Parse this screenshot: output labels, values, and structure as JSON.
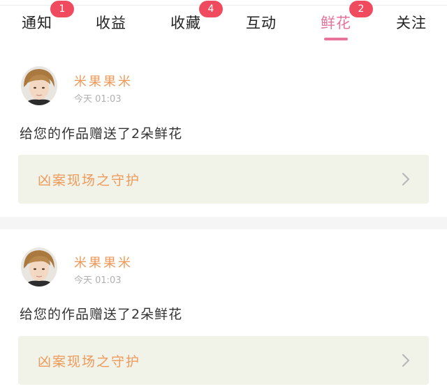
{
  "tabs": [
    {
      "label": "通知",
      "badge": "1",
      "active": false
    },
    {
      "label": "收益",
      "badge": "",
      "active": false
    },
    {
      "label": "收藏",
      "badge": "4",
      "active": false
    },
    {
      "label": "互动",
      "badge": "",
      "active": false
    },
    {
      "label": "鲜花",
      "badge": "2",
      "active": true
    },
    {
      "label": "关注",
      "badge": "",
      "active": false
    }
  ],
  "notifications": [
    {
      "username": "米果果米",
      "time": "今天 01:03",
      "message": "给您的作品赠送了2朵鲜花",
      "work_title": "凶案现场之守护"
    },
    {
      "username": "米果果米",
      "time": "今天 01:03",
      "message": "给您的作品赠送了2朵鲜花",
      "work_title": "凶案现场之守护"
    }
  ],
  "icons": {
    "chevron": "chevron-right-icon",
    "avatar": "user-avatar"
  },
  "colors": {
    "accent": "#e8739a",
    "badge": "#f04a5e",
    "username": "#ee9a5a",
    "card_bg": "#f1f2e8"
  }
}
